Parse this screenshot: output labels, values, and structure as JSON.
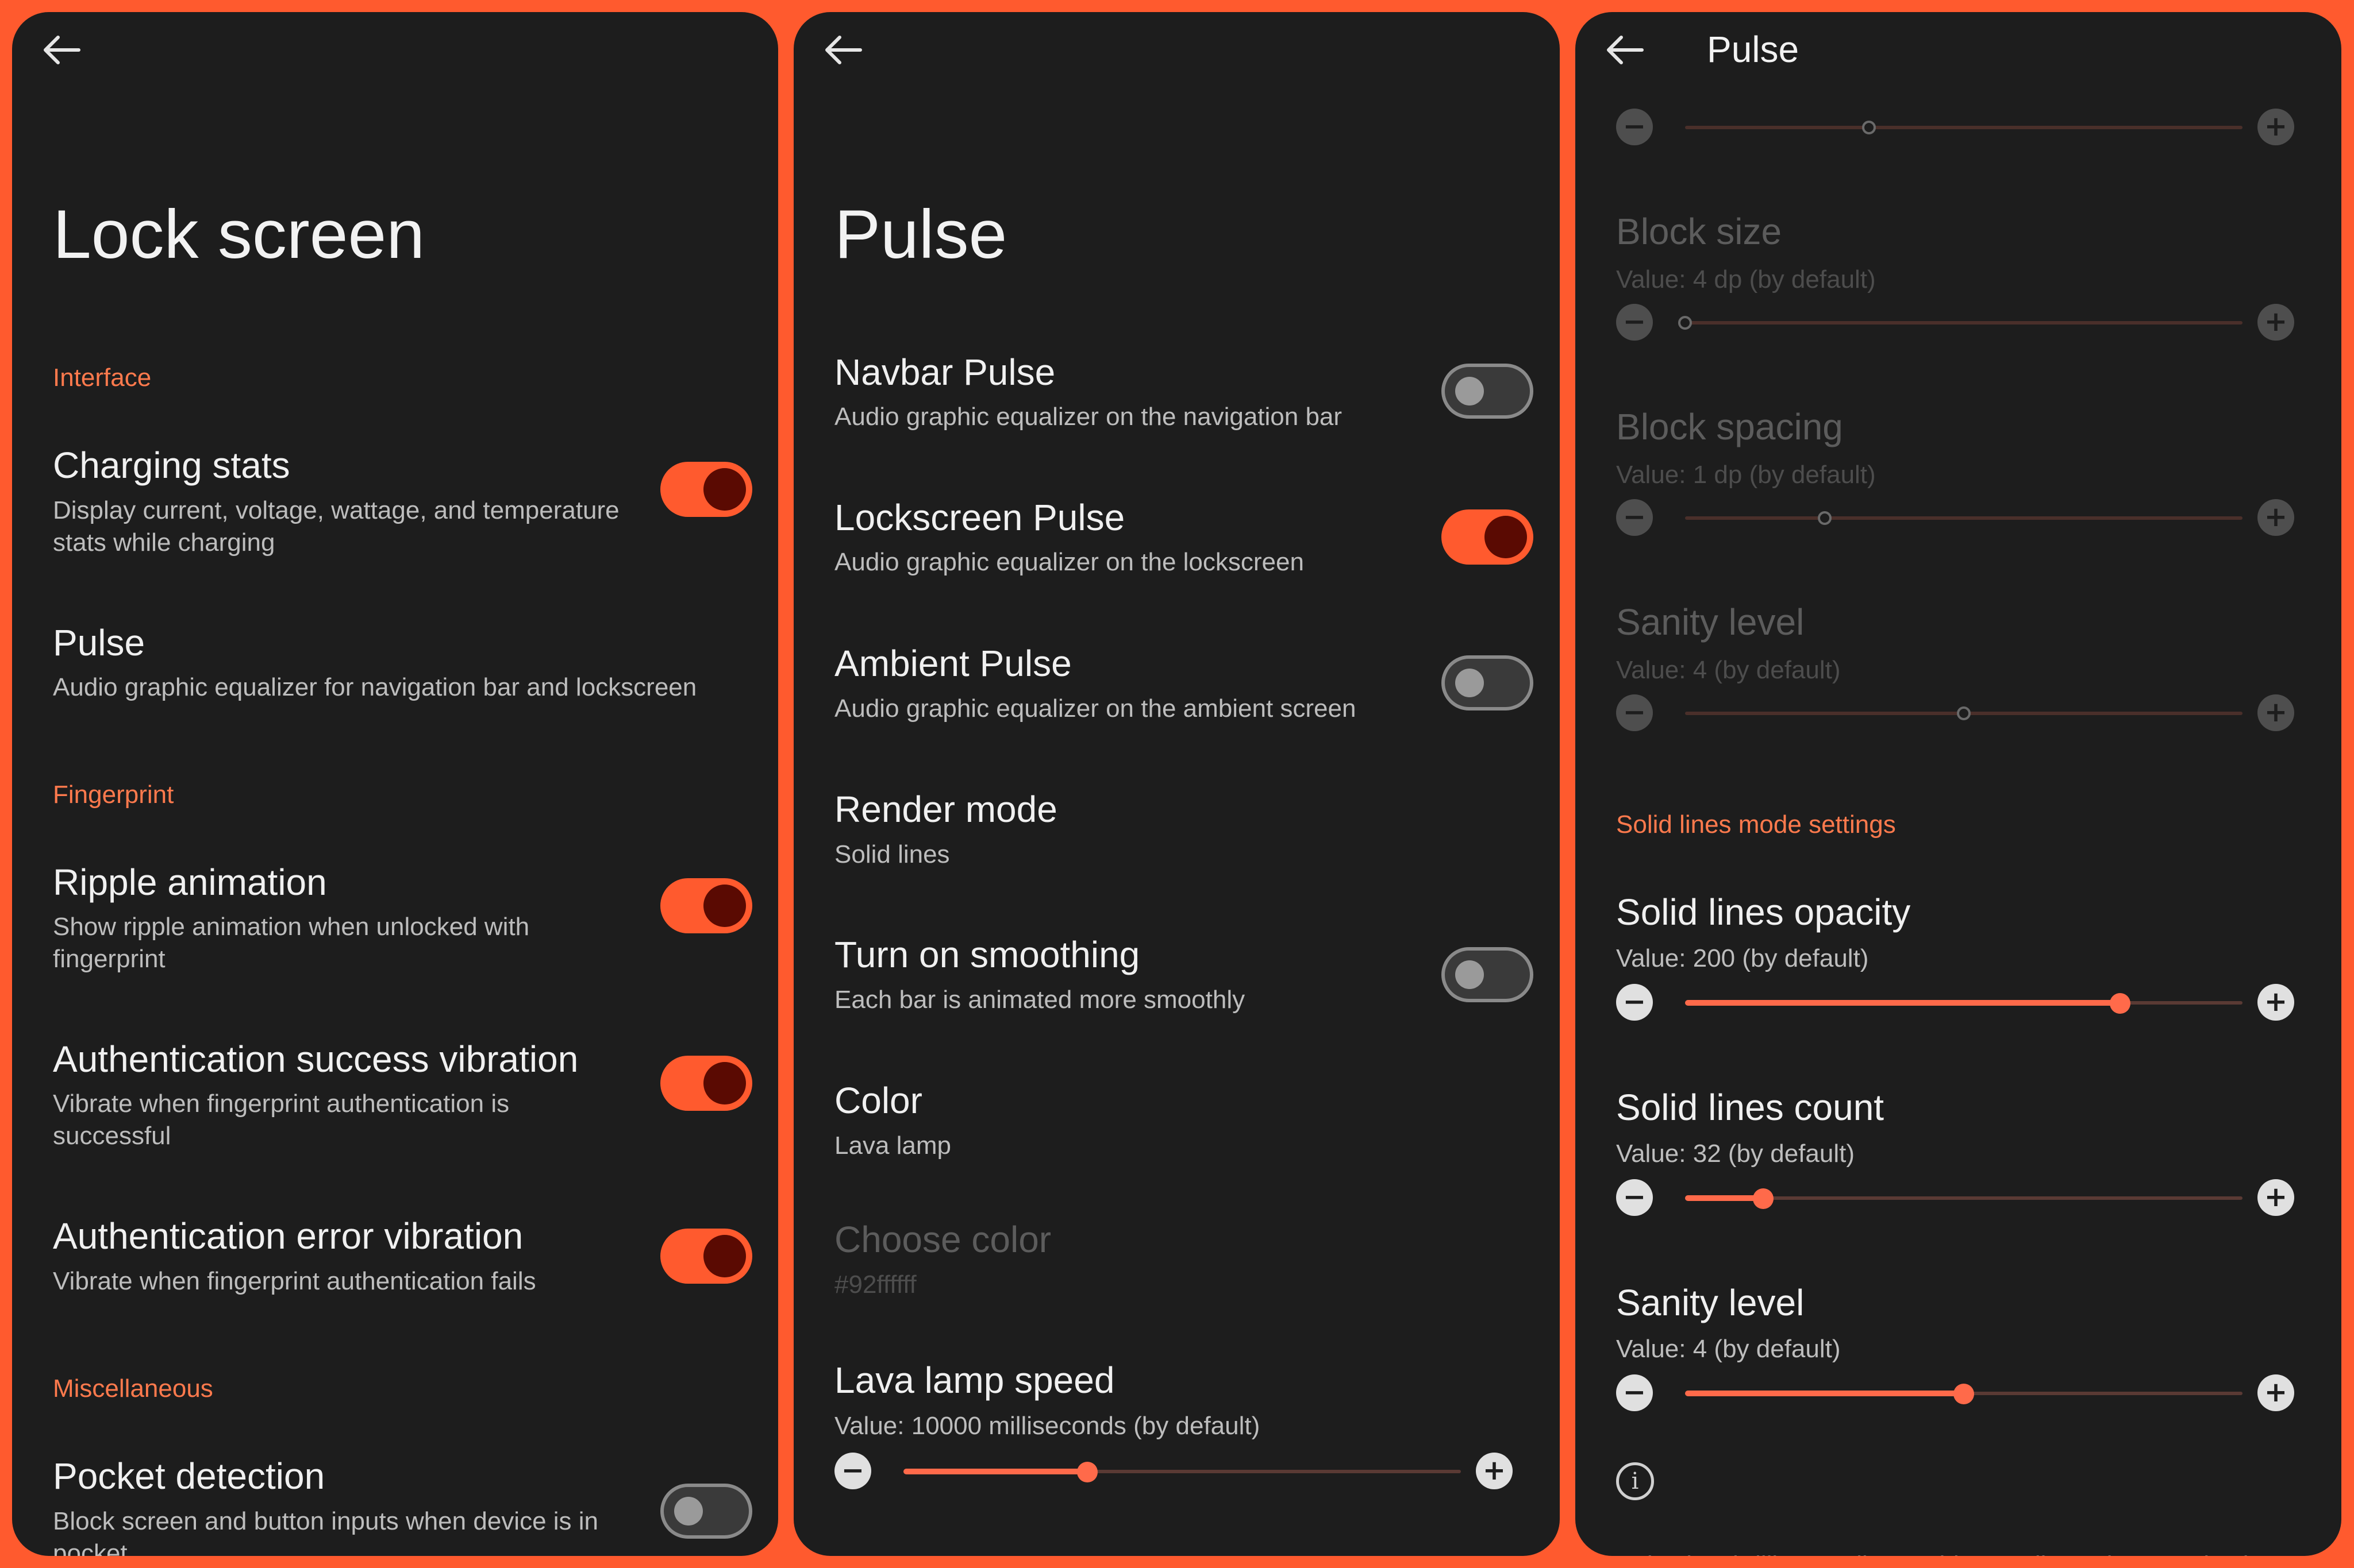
{
  "colors": {
    "accent": "#ff5a2e",
    "panel_bg": "#1d1d1d",
    "section": "#ff7a4d",
    "knob_on": "#5a0a02"
  },
  "lock": {
    "title": "Lock screen",
    "sections": {
      "interface": "Interface",
      "fingerprint": "Fingerprint",
      "misc": "Miscellaneous"
    },
    "items": [
      {
        "title": "Charging stats",
        "sub": "Display current, voltage, wattage, and temperature stats while charging",
        "toggle": true
      },
      {
        "title": "Pulse",
        "sub": "Audio graphic equalizer for navigation bar and lockscreen"
      },
      {
        "title": "Ripple animation",
        "sub": "Show ripple animation when unlocked with fingerprint",
        "toggle": true
      },
      {
        "title": "Authentication success vibration",
        "sub": "Vibrate when fingerprint authentication is successful",
        "toggle": true
      },
      {
        "title": "Authentication error vibration",
        "sub": "Vibrate when fingerprint authentication fails",
        "toggle": true
      },
      {
        "title": "Pocket detection",
        "sub": "Block screen and button inputs when device is in pocket",
        "toggle": false
      }
    ]
  },
  "pulse": {
    "title": "Pulse",
    "items": [
      {
        "title": "Navbar Pulse",
        "sub": "Audio graphic equalizer on the navigation bar",
        "toggle": false
      },
      {
        "title": "Lockscreen Pulse",
        "sub": "Audio graphic equalizer on the lockscreen",
        "toggle": true
      },
      {
        "title": "Ambient Pulse",
        "sub": "Audio graphic equalizer on the ambient screen",
        "toggle": false
      },
      {
        "title": "Render mode",
        "sub": "Solid lines"
      },
      {
        "title": "Turn on smoothing",
        "sub": "Each bar is animated more smoothly",
        "toggle": false
      },
      {
        "title": "Color",
        "sub": "Lava lamp"
      },
      {
        "title": "Choose color",
        "sub": "#92ffffff",
        "disabled": true
      },
      {
        "title": "Lava lamp speed",
        "sub": "Value: 10000 milliseconds (by default)",
        "slider_fraction": 0.33
      }
    ]
  },
  "pulse_detail": {
    "header": "Pulse",
    "top_slider_fraction": 0.33,
    "items": [
      {
        "title": "Block size",
        "sub": "Value: 4 dp (by default)",
        "slider_fraction": 0.0,
        "disabled": true
      },
      {
        "title": "Block spacing",
        "sub": "Value: 1 dp (by default)",
        "slider_fraction": 0.25,
        "disabled": true
      },
      {
        "title": "Sanity level",
        "sub": "Value: 4 (by default)",
        "slider_fraction": 0.5,
        "disabled": true
      }
    ],
    "section": "Solid lines mode settings",
    "solid_items": [
      {
        "title": "Solid lines opacity",
        "sub": "Value: 200 (by default)",
        "slider_fraction": 0.78
      },
      {
        "title": "Solid lines count",
        "sub": "Value: 32 (by default)",
        "slider_fraction": 0.14
      },
      {
        "title": "Sanity level",
        "sub": "Value: 4 (by default)",
        "slider_fraction": 0.5
      }
    ],
    "info_icon": "info-icon",
    "footer": "Pulse is a brilliant audio graphic equalizer when music plays"
  }
}
